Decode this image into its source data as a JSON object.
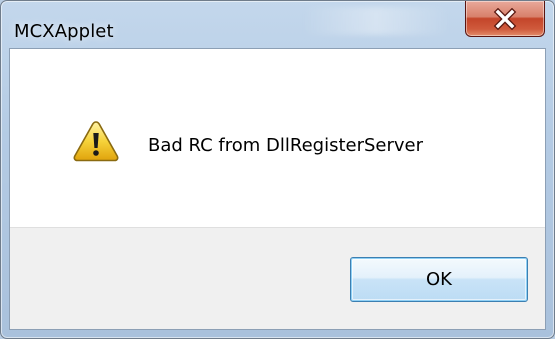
{
  "window": {
    "title": "MCXApplet"
  },
  "dialog": {
    "icon": "warning-icon",
    "message": "Bad RC from DllRegisterServer",
    "ok_label": "OK"
  },
  "colors": {
    "close_button": "#c4452a",
    "ok_border": "#3c7fb1",
    "footer_bg": "#f0f0f0",
    "warning_yellow": "#f6d23a"
  }
}
